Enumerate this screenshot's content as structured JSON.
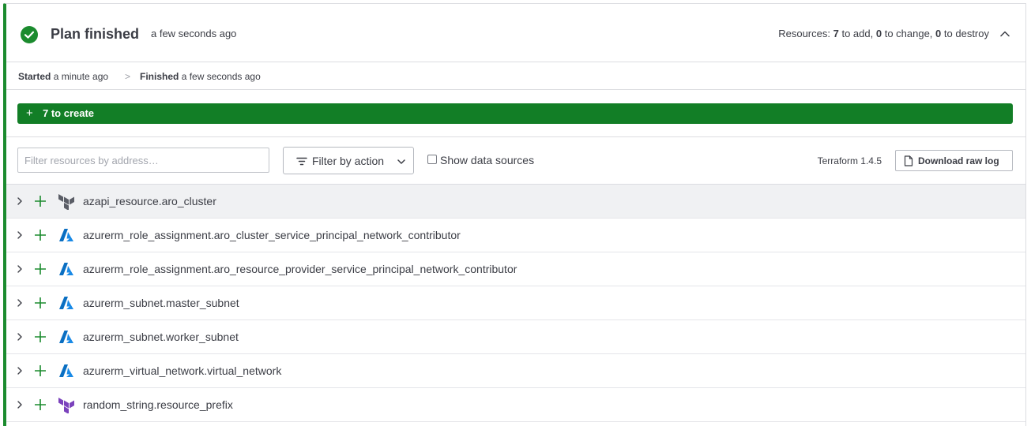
{
  "header": {
    "title": "Plan finished",
    "time": "a few seconds ago",
    "resources_prefix": "Resources:",
    "add_count": "7",
    "add_label": "to add,",
    "change_count": "0",
    "change_label": "to change,",
    "destroy_count": "0",
    "destroy_label": "to destroy",
    "status_color": "#1b8b2e"
  },
  "timing": {
    "started_label": "Started",
    "started_value": "a minute ago",
    "separator": ">",
    "finished_label": "Finished",
    "finished_value": "a few seconds ago"
  },
  "create_bar": {
    "plus": "+",
    "label": "7 to create",
    "color": "#127e26"
  },
  "toolbar": {
    "filter_placeholder": "Filter resources by address…",
    "filter_action_label": "Filter by action",
    "show_data_sources_label": "Show data sources",
    "terraform_version": "Terraform 1.4.5",
    "download_label": "Download raw log"
  },
  "resources": [
    {
      "address": "azapi_resource.aro_cluster",
      "provider_icon": "terraform-icon-gray"
    },
    {
      "address": "azurerm_role_assignment.aro_cluster_service_principal_network_contributor",
      "provider_icon": "azure-icon"
    },
    {
      "address": "azurerm_role_assignment.aro_resource_provider_service_principal_network_contributor",
      "provider_icon": "azure-icon"
    },
    {
      "address": "azurerm_subnet.master_subnet",
      "provider_icon": "azure-icon"
    },
    {
      "address": "azurerm_subnet.worker_subnet",
      "provider_icon": "azure-icon"
    },
    {
      "address": "azurerm_virtual_network.virtual_network",
      "provider_icon": "azure-icon"
    },
    {
      "address": "random_string.resource_prefix",
      "provider_icon": "terraform-icon-purple"
    }
  ]
}
